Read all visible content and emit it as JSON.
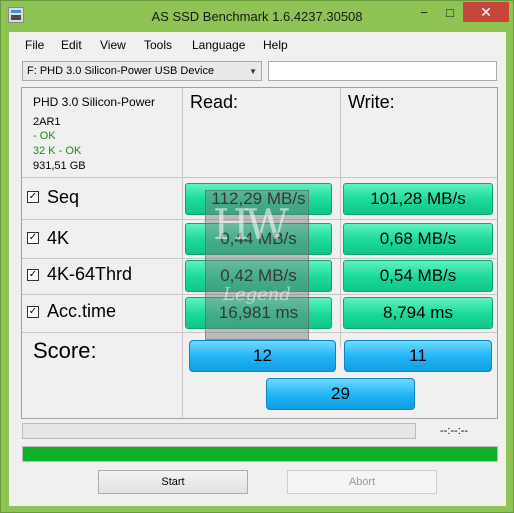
{
  "window": {
    "title": "AS SSD Benchmark 1.6.4237.30508",
    "minimize_glyph": "−",
    "maximize_glyph": "□",
    "close_glyph": "✕"
  },
  "menu": [
    "File",
    "Edit",
    "View",
    "Tools",
    "Language",
    "Help"
  ],
  "drive_select": {
    "value": "F: PHD 3.0 Silicon-Power USB Device",
    "arrow": "▼"
  },
  "text_field": {
    "value": ""
  },
  "device_info": {
    "name": "PHD 3.0 Silicon-Power",
    "firmware": "2AR1",
    "status1": " - OK",
    "status2": "32 K - OK",
    "size": "931,51 GB"
  },
  "columns": {
    "read": "Read:",
    "write": "Write:"
  },
  "tests": [
    {
      "label": "Seq",
      "checked": true,
      "read": "112,29 MB/s",
      "write": "101,28 MB/s"
    },
    {
      "label": "4K",
      "checked": true,
      "read": "0,44 MB/s",
      "write": "0,68 MB/s"
    },
    {
      "label": "4K-64Thrd",
      "checked": true,
      "read": "0,42 MB/s",
      "write": "0,54 MB/s"
    },
    {
      "label": "Acc.time",
      "checked": true,
      "read": "16,981 ms",
      "write": "8,794 ms"
    }
  ],
  "check_glyph": "✓",
  "score": {
    "label": "Score:",
    "read": "12",
    "write": "11",
    "total": "29"
  },
  "elapsed_time": "--:--:--",
  "progress": {
    "top_fraction": 0,
    "bottom_fraction": 1
  },
  "buttons": {
    "start": "Start",
    "abort": "Abort"
  },
  "colors": {
    "frame": "#8fc455",
    "result_green": "#19d99a",
    "score_blue": "#1fb3f5",
    "progress_green": "#0fb02a",
    "close_red": "#c7463c"
  },
  "watermark": {
    "logo": "HW",
    "word": "Legend"
  }
}
